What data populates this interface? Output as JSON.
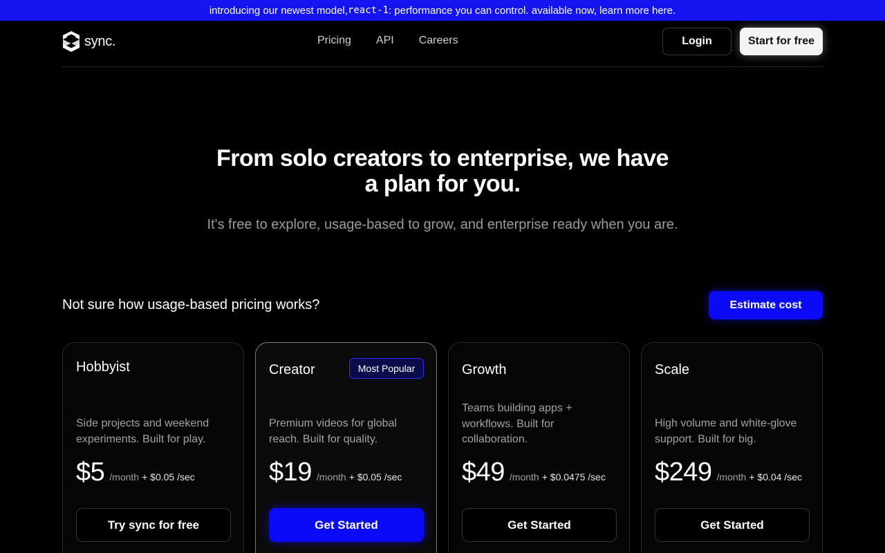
{
  "banner": {
    "prefix": "introducing our newest model, ",
    "model": "react-1",
    "suffix": ": performance you can control. available now, learn more here."
  },
  "nav": {
    "logo_text": "sync.",
    "links": [
      "Pricing",
      "API",
      "Careers"
    ],
    "login_label": "Login",
    "start_label": "Start for free"
  },
  "hero": {
    "title_line1": "From solo creators to enterprise, we have",
    "title_line2": "a plan for you.",
    "subtitle": "It's free to explore, usage-based to grow, and enterprise ready when you are."
  },
  "usage": {
    "question": "Not sure how usage-based pricing works?",
    "estimate_label": "Estimate cost"
  },
  "plans": [
    {
      "name": "Hobbyist",
      "description": "Side projects and weekend experiments. Built for play.",
      "price": "$5",
      "period": "/month",
      "usage": "+ $0.05 /sec",
      "cta": "Try sync for free"
    },
    {
      "name": "Creator",
      "badge": "Most Popular",
      "description": "Premium videos for global reach. Built for quality.",
      "price": "$19",
      "period": "/month",
      "usage": "+ $0.05 /sec",
      "cta": "Get Started"
    },
    {
      "name": "Growth",
      "description": "Teams building apps + workflows. Built for collaboration.",
      "price": "$49",
      "period": "/month",
      "usage": "+ $0.0475 /sec",
      "cta": "Get Started"
    },
    {
      "name": "Scale",
      "description": "High volume and white-glove support. Built for big.",
      "price": "$249",
      "period": "/month",
      "usage": "+ $0.04 /sec",
      "cta": "Get Started"
    }
  ],
  "colors": {
    "banner": "#1414f0",
    "accent": "#0a0af5",
    "background": "#000000"
  }
}
